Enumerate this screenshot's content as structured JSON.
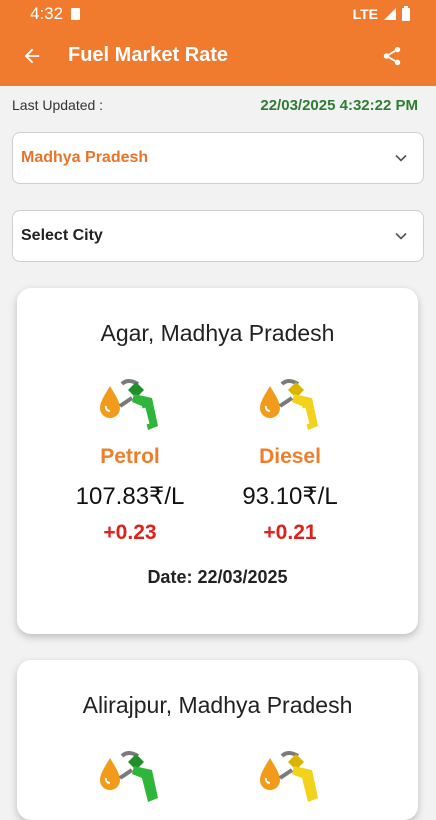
{
  "status_bar": {
    "time": "4:32",
    "network": "LTE"
  },
  "app_bar": {
    "title": "Fuel Market Rate"
  },
  "last_updated": {
    "label": "Last Updated :",
    "value": "22/03/2025 4:32:22 PM"
  },
  "state_select": {
    "value": "Madhya Pradesh"
  },
  "city_select": {
    "value": "Select City"
  },
  "cards": [
    {
      "location": "Agar, Madhya Pradesh",
      "petrol": {
        "name": "Petrol",
        "price": "107.83₹/L",
        "change": "+0.23"
      },
      "diesel": {
        "name": "Diesel",
        "price": "93.10₹/L",
        "change": "+0.21"
      },
      "date": "Date: 22/03/2025"
    },
    {
      "location": "Alirajpur, Madhya Pradesh"
    }
  ],
  "colors": {
    "primary": "#f07a2e",
    "fuel_label": "#ee7d2c",
    "change": "#e0201b",
    "updated": "#2e7d32",
    "petrol_nozzle": "#2fb53a",
    "diesel_nozzle": "#f2d21a"
  },
  "icons": {
    "back": "arrow-left-icon",
    "share": "share-icon",
    "dropdown": "chevron-down-icon",
    "petrol": "petrol-pump-nozzle-icon",
    "diesel": "diesel-pump-nozzle-icon"
  }
}
